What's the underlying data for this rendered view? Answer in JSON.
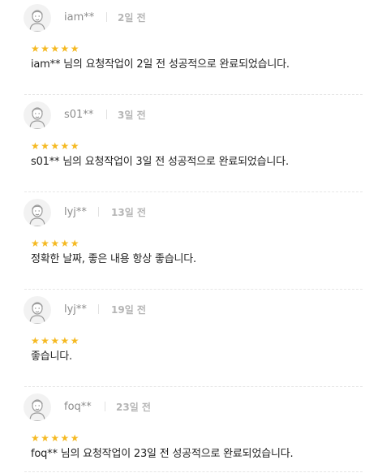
{
  "reviews": [
    {
      "user": "iam**",
      "time": "2일 전",
      "rating": 5,
      "text": "iam** 님의 요청작업이 2일 전 성공적으로 완료되었습니다."
    },
    {
      "user": "s01**",
      "time": "3일 전",
      "rating": 5,
      "text": "s01** 님의 요청작업이 3일 전 성공적으로 완료되었습니다."
    },
    {
      "user": "lyj**",
      "time": "13일 전",
      "rating": 5,
      "text": "정확한 날짜, 좋은 내용 항상 좋습니다."
    },
    {
      "user": "lyj**",
      "time": "19일 전",
      "rating": 5,
      "text": "좋습니다."
    },
    {
      "user": "foq**",
      "time": "23일 전",
      "rating": 5,
      "text": "foq** 님의 요청작업이 23일 전 성공적으로 완료되었습니다."
    }
  ],
  "colors": {
    "star": "#f5b921",
    "username": "#8c8c8c",
    "time": "#b5b5b5",
    "text": "#222222"
  },
  "icons": {
    "avatar": "default-user-avatar-icon",
    "star": "star-icon"
  }
}
